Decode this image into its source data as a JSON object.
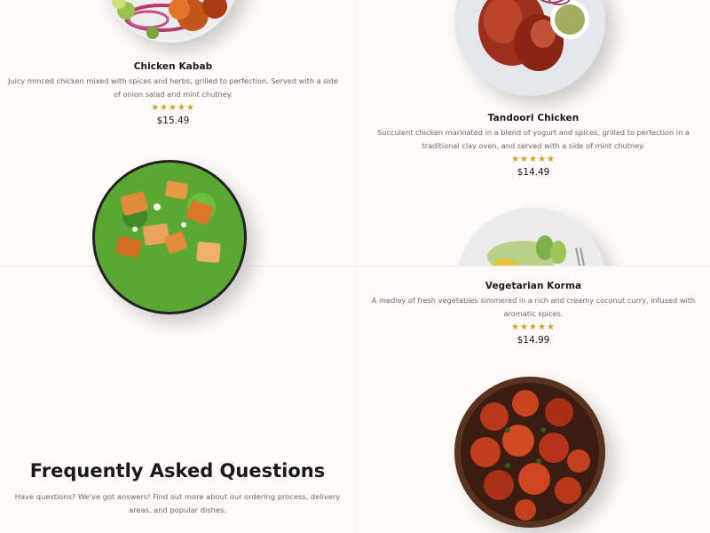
{
  "menu_items": [
    {
      "name": "Chicken Kabab",
      "description": "Juicy minced chicken mixed with spices and herbs, grilled to perfection. Served with a side of onion salad and mint chutney.",
      "rating": 5,
      "stars": "★★★★★",
      "price": "$15.49",
      "image": "chicken-kabab-plate"
    },
    {
      "name": "Tandoori Chicken",
      "description": "Succulent chicken marinated in a blend of yogurt and spices, grilled to perfection in a traditional clay oven, and served with a side of mint chutney.",
      "rating": 5,
      "stars": "★★★★★",
      "price": "$14.49",
      "image": "tandoori-chicken-plate"
    },
    {
      "name": "Vegetarian Korma",
      "description": "A medley of fresh vegetables simmered in a rich and creamy coconut curry, infused with aromatic spices.",
      "rating": 5,
      "stars": "★★★★★",
      "price": "$14.99",
      "image": "vegetarian-korma-plate"
    }
  ],
  "other_images": [
    "palak-paneer-plate",
    "chicken-65-plate"
  ],
  "faq": {
    "title": "Frequently Asked Questions",
    "description": "Have questions? We've got answers! Find out more about our ordering process, delivery areas, and popular dishes."
  },
  "colors": {
    "background": "#fdfaf9",
    "star": "#d4a020",
    "text": "#1a1a1a",
    "muted": "#6b6b6b"
  }
}
